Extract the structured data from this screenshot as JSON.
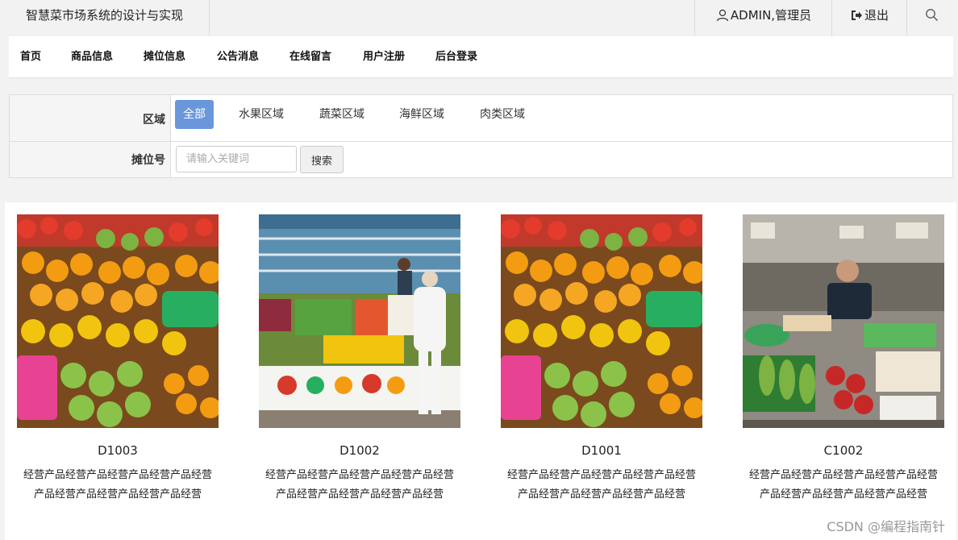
{
  "header": {
    "site_title": "智慧菜市场系统的设计与实现",
    "user_label": "ADMIN,管理员",
    "logout_label": "退出"
  },
  "nav": {
    "items": [
      "首页",
      "商品信息",
      "摊位信息",
      "公告消息",
      "在线留言",
      "用户注册",
      "后台登录"
    ]
  },
  "filter": {
    "region_label": "区域",
    "regions": [
      "全部",
      "水果区域",
      "蔬菜区域",
      "海鲜区域",
      "肉类区域"
    ],
    "active_region": "全部",
    "stall_label": "摊位号",
    "search_placeholder": "请输入关键词",
    "search_button": "搜索"
  },
  "stalls": [
    {
      "name": "D1003",
      "desc": "经营产品经营产品经营产品经营产品经营产品经营产品经营产品经营产品经营",
      "image": "fruit-market-photo"
    },
    {
      "name": "D1002",
      "desc": "经营产品经营产品经营产品经营产品经营产品经营产品经营产品经营产品经营",
      "image": "vegetable-stall-photo"
    },
    {
      "name": "D1001",
      "desc": "经营产品经营产品经营产品经营产品经营产品经营产品经营产品经营产品经营",
      "image": "fruit-market-photo"
    },
    {
      "name": "C1002",
      "desc": "经营产品经营产品经营产品经营产品经营产品经营产品经营产品经营产品经营",
      "image": "vendor-stall-photo"
    }
  ],
  "watermark": "CSDN @编程指南针",
  "icons": {
    "user": "user-icon",
    "logout": "logout-icon",
    "search": "search-icon"
  },
  "colors": {
    "accent": "#6a97dc",
    "topbar_bg": "#f2f2f2"
  }
}
